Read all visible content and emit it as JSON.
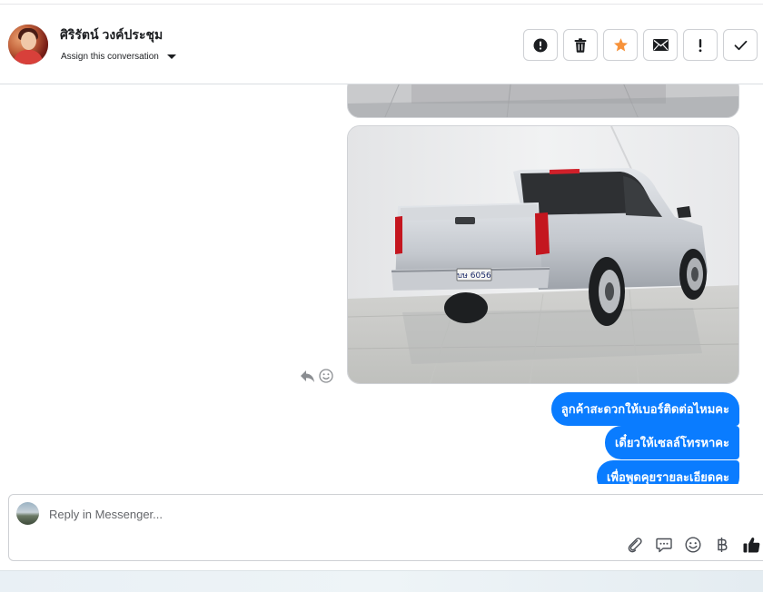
{
  "header": {
    "contact_name": "ศิริรัตน์ วงค์ประชุม",
    "assign_label": "Assign this conversation",
    "actions": [
      {
        "icon": "alert-icon",
        "label": "Mark as spam"
      },
      {
        "icon": "trash-icon",
        "label": "Delete"
      },
      {
        "icon": "star-icon",
        "label": "Star"
      },
      {
        "icon": "envelope-icon",
        "label": "Mark as unread"
      },
      {
        "icon": "exclamation-icon",
        "label": "Follow up"
      },
      {
        "icon": "check-icon",
        "label": "Done"
      }
    ],
    "star_color": "#f7923a"
  },
  "chat": {
    "truck_plate": "บษ 6056",
    "messages": [
      {
        "text": "ลูกค้าสะดวกให้เบอร์ติดต่อไหมคะ"
      },
      {
        "text": "เดี๋ยวให้เซลล์โทรหาคะ"
      },
      {
        "text": "เพื่อพูดคุยรายละเอียดคะ"
      }
    ],
    "bubble_color": "#0a7cff"
  },
  "composer": {
    "placeholder": "Reply in Messenger...",
    "tools": [
      "paperclip-icon",
      "saved-reply-icon",
      "emoji-icon",
      "baht-icon",
      "thumbs-up-icon"
    ]
  }
}
